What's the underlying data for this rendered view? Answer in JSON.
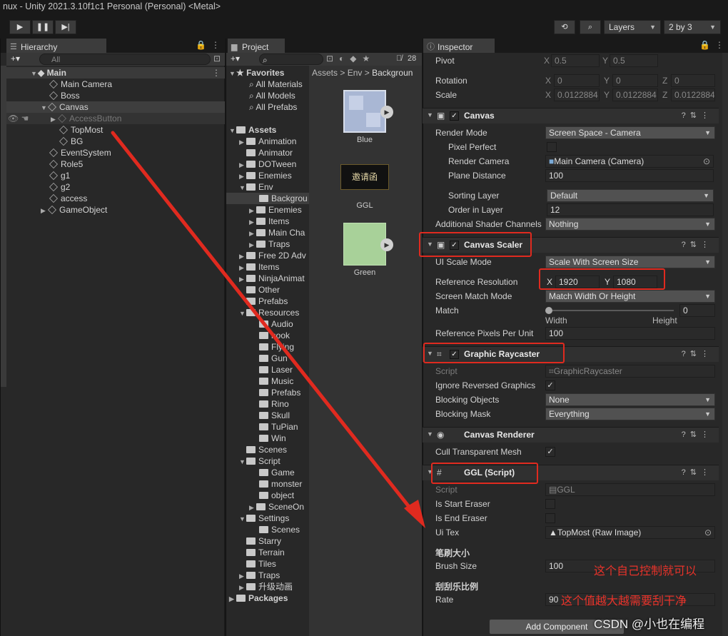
{
  "window": {
    "title": "nux - Unity 2021.3.10f1c1 Personal (Personal) <Metal>"
  },
  "toolbar": {
    "play": "▶",
    "pause": "❚❚",
    "step": "▶|",
    "layers": "Layers",
    "layout": "2 by 3"
  },
  "hierarchy": {
    "tab": "Hierarchy",
    "add": "+▾",
    "search_placeholder": "All",
    "items": [
      "Main",
      "Main Camera",
      "Boss",
      "Canvas",
      "AccessButton",
      "TopMost",
      "BG",
      "EventSystem",
      "Role5",
      "g1",
      "g2",
      "access",
      "GameObject"
    ]
  },
  "project": {
    "tab": "Project",
    "add": "+▾",
    "hidden_count": "28",
    "breadcrumb": [
      "Assets",
      "Env",
      "Backgroun"
    ],
    "tree": [
      "Favorites",
      "All Materials",
      "All Models",
      "All Prefabs",
      "Assets",
      "Animation",
      "Animator",
      "DOTween",
      "Enemies",
      "Env",
      "Backgrou",
      "Enemies",
      "Items",
      "Main Cha",
      "Traps",
      "Free 2D Adv",
      "Items",
      "NinjaAnimat",
      "Other",
      "Prefabs",
      "Resources",
      "Audio",
      "hook",
      "Flying",
      "Gun",
      "Laser",
      "Music",
      "Prefabs",
      "Rino",
      "Skull",
      "TuPian",
      "Win",
      "Scenes",
      "Script",
      "Game",
      "monster",
      "object",
      "SceneOn",
      "Settings",
      "Scenes",
      "Starry",
      "Terrain",
      "Tiles",
      "Traps",
      "升级动画",
      "Packages"
    ],
    "assets": [
      "Blue",
      "GGL",
      "Green"
    ],
    "ggl_text": "邀请函"
  },
  "inspector": {
    "tab": "Inspector",
    "transform": {
      "pivot": {
        "label": "Pivot",
        "x": "0.5",
        "y": "0.5"
      },
      "rotation": {
        "label": "Rotation",
        "x": "0",
        "y": "0",
        "z": "0"
      },
      "scale": {
        "label": "Scale",
        "x": "0.0122884",
        "y": "0.0122884",
        "z": "0.0122884"
      },
      "axes": [
        "X",
        "Y",
        "Z"
      ]
    },
    "canvas": {
      "title": "Canvas",
      "render_mode": {
        "label": "Render Mode",
        "value": "Screen Space - Camera"
      },
      "pixel_perfect": {
        "label": "Pixel Perfect"
      },
      "render_camera": {
        "label": "Render Camera",
        "value": "Main Camera (Camera)"
      },
      "plane_distance": {
        "label": "Plane Distance",
        "value": "100"
      },
      "sorting_layer": {
        "label": "Sorting Layer",
        "value": "Default"
      },
      "order_in_layer": {
        "label": "Order in Layer",
        "value": "12"
      },
      "shader_channels": {
        "label": "Additional Shader Channels",
        "value": "Nothing"
      }
    },
    "canvas_scaler": {
      "title": "Canvas Scaler",
      "ui_scale_mode": {
        "label": "UI Scale Mode",
        "value": "Scale With Screen Size"
      },
      "reference_resolution": {
        "label": "Reference Resolution",
        "x": "1920",
        "y": "1080"
      },
      "screen_match_mode": {
        "label": "Screen Match Mode",
        "value": "Match Width Or Height"
      },
      "match": {
        "label": "Match",
        "value": "0",
        "width": "Width",
        "height": "Height"
      },
      "ref_pixels": {
        "label": "Reference Pixels Per Unit",
        "value": "100"
      }
    },
    "graphic_raycaster": {
      "title": "Graphic Raycaster",
      "script": {
        "label": "Script",
        "value": "GraphicRaycaster"
      },
      "ignore_reversed": {
        "label": "Ignore Reversed Graphics"
      },
      "blocking_objects": {
        "label": "Blocking Objects",
        "value": "None"
      },
      "blocking_mask": {
        "label": "Blocking Mask",
        "value": "Everything"
      }
    },
    "canvas_renderer": {
      "title": "Canvas Renderer",
      "cull": {
        "label": "Cull Transparent Mesh"
      }
    },
    "ggl_script": {
      "title": "GGL (Script)",
      "script": {
        "label": "Script",
        "value": "GGL"
      },
      "start_eraser": {
        "label": "Is Start Eraser"
      },
      "end_eraser": {
        "label": "Is End Eraser"
      },
      "ui_tex": {
        "label": "Ui Tex",
        "value": "TopMost (Raw Image)"
      },
      "brush_header": "笔刷大小",
      "brush_size": {
        "label": "Brush Size",
        "value": "100"
      },
      "rate_header": "刮刮乐比例",
      "rate": {
        "label": "Rate",
        "value": "90"
      }
    },
    "add_component": "Add Component"
  },
  "annotations": {
    "brush_note": "这个自己控制就可以",
    "rate_note": "这个值越大越需要刮干净",
    "watermark": "CSDN @小也在编程"
  },
  "colors": {
    "highlight_red": "#e02a1f",
    "selection": "#3e3e3e"
  }
}
